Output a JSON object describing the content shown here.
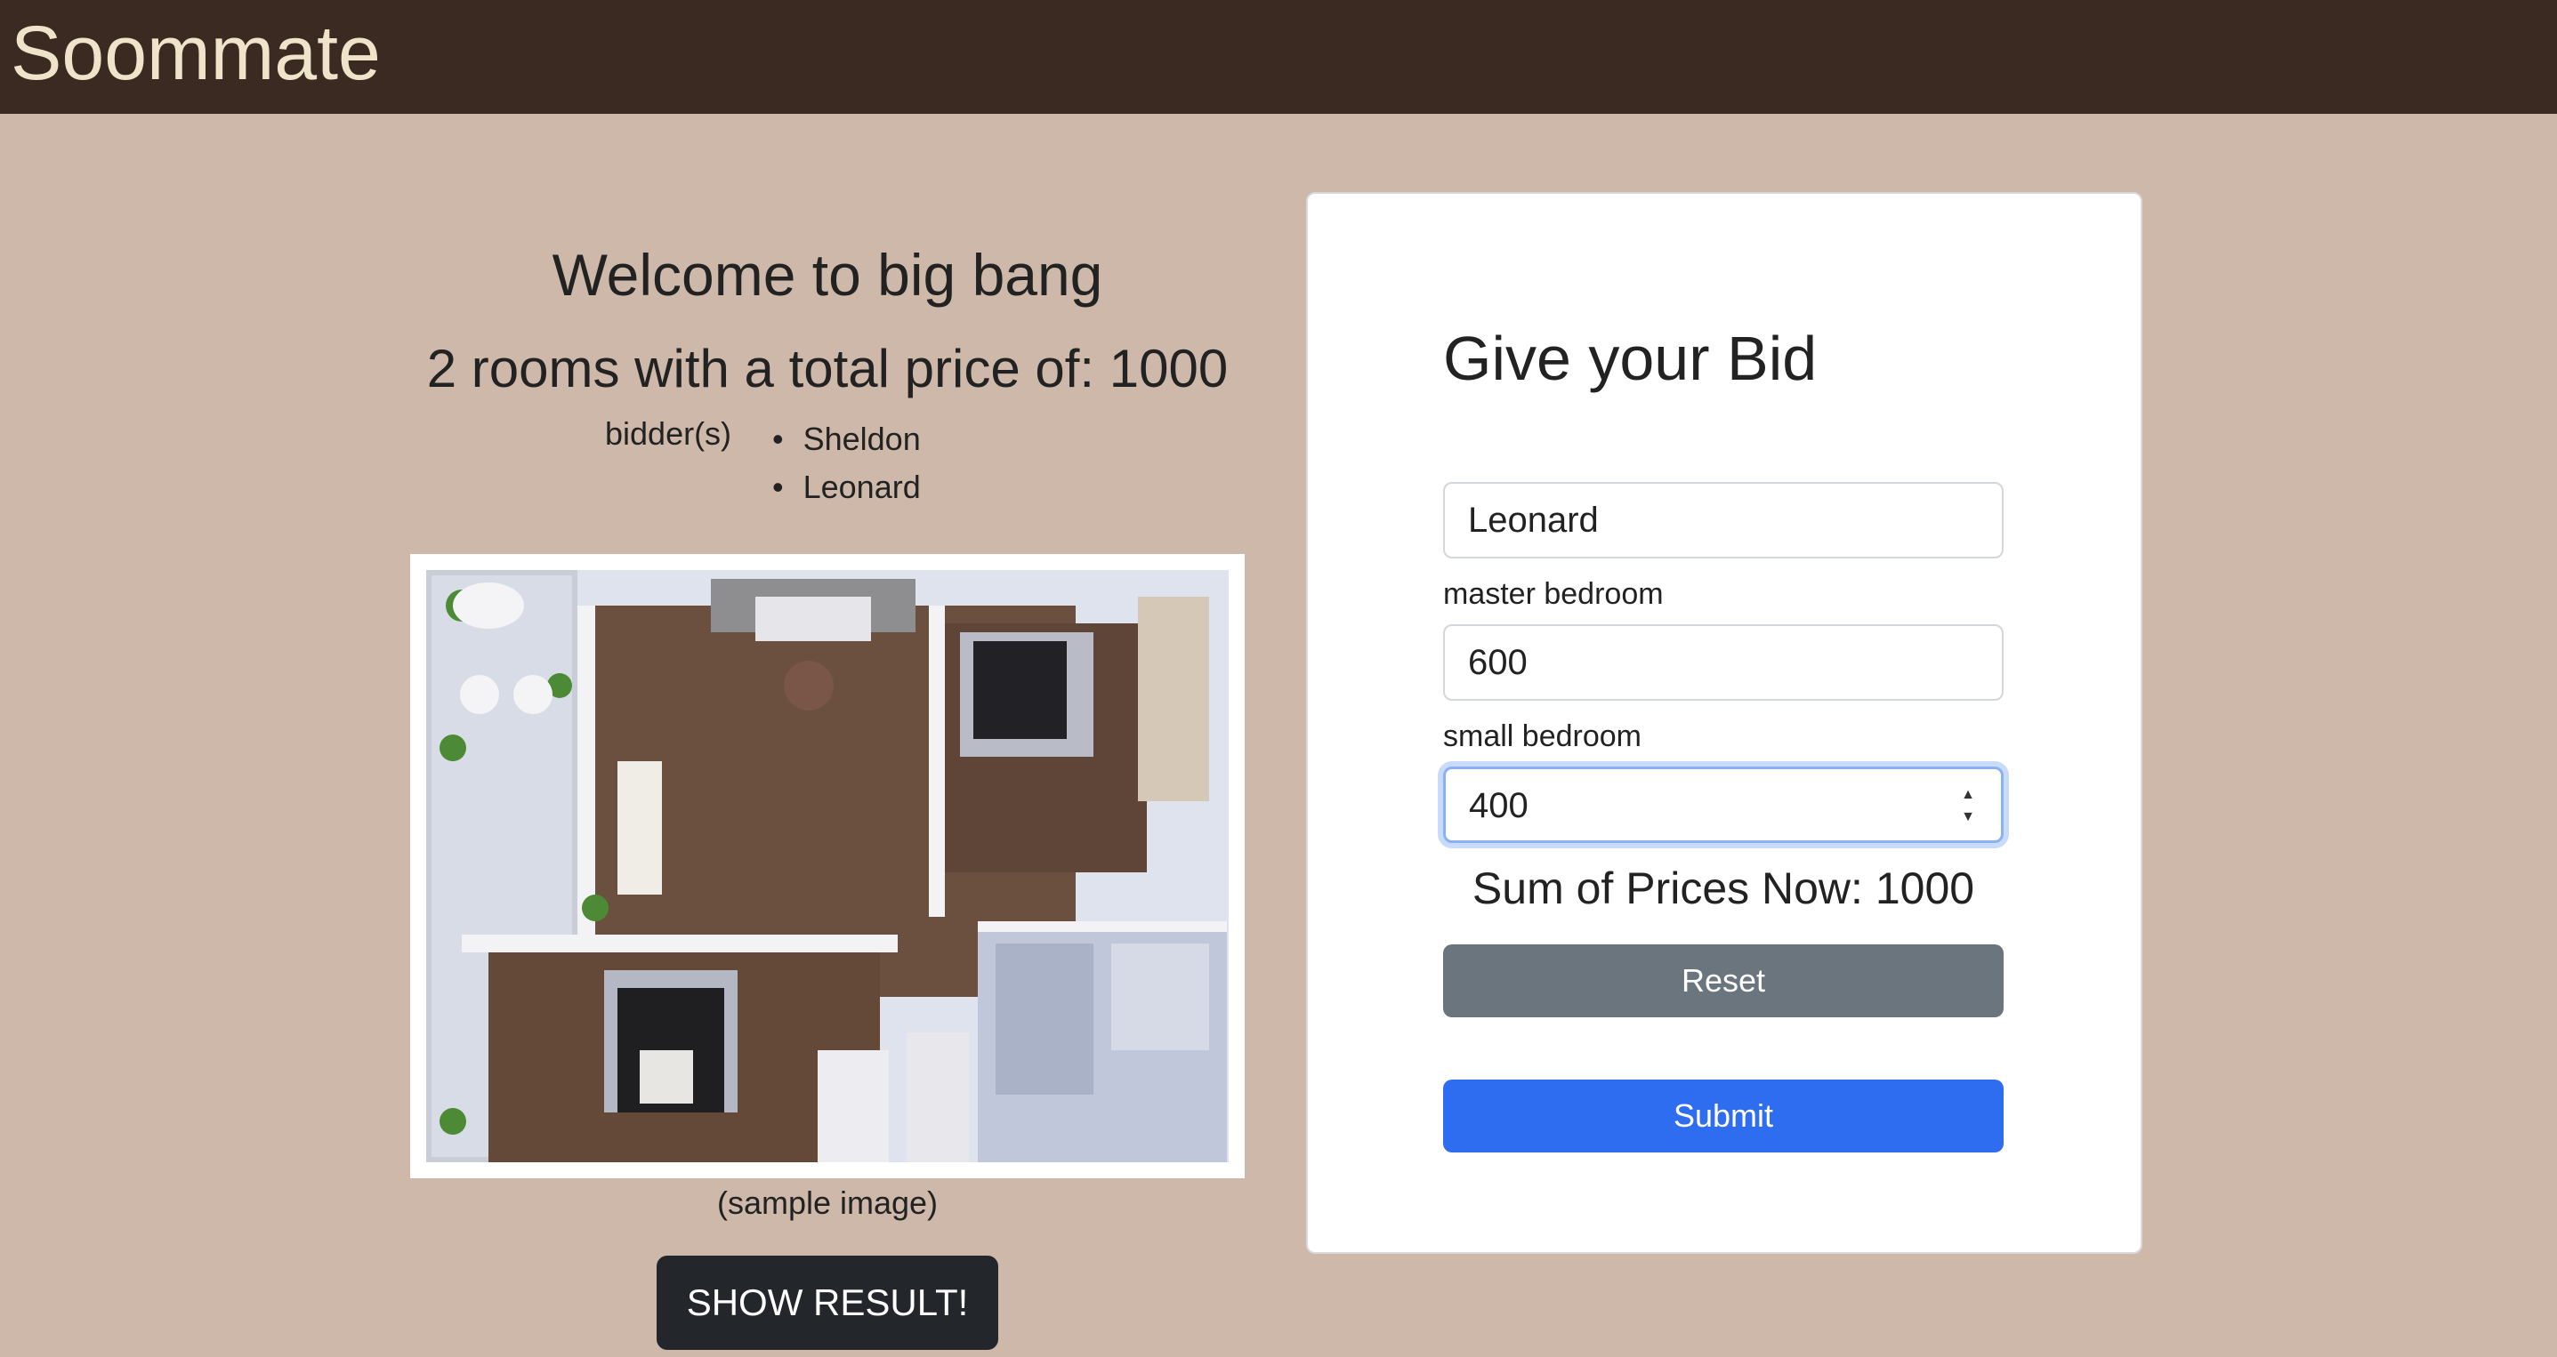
{
  "navbar": {
    "brand": "Soommate"
  },
  "info": {
    "welcome": "Welcome to big bang",
    "summary": "2 rooms with a total price of: 1000",
    "bidders_label": "bidder(s)",
    "bidders": [
      "Sheldon",
      "Leonard"
    ],
    "image_caption": "(sample image)",
    "show_result_label": "SHOW RESULT!"
  },
  "bid_form": {
    "title": "Give your Bid",
    "bidder_value": "Leonard",
    "rooms": [
      {
        "label": "master bedroom",
        "value": "600"
      },
      {
        "label": "small bedroom",
        "value": "400"
      }
    ],
    "sum_text": "Sum of Prices Now: 1000",
    "reset_label": "Reset",
    "submit_label": "Submit"
  }
}
